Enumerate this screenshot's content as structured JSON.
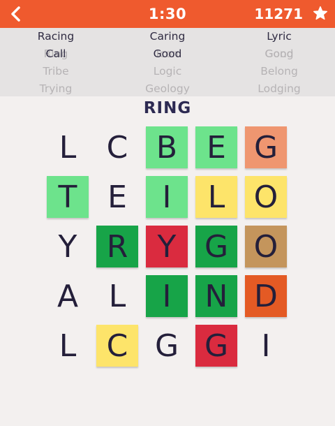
{
  "header": {
    "timer": "1:30",
    "score": "11271",
    "bar_color": "#ef5a2e"
  },
  "word_columns": [
    {
      "active": "Racing",
      "faded": [
        "Ring",
        "Tribe",
        "Trying"
      ],
      "overlap": "Call"
    },
    {
      "active": "Caring",
      "faded": [
        "Icon",
        "Logic",
        "Geology"
      ],
      "overlap": "Good"
    },
    {
      "active": "Lyric",
      "faded": [
        "Gong",
        "Belong",
        "Lodging"
      ],
      "overlap": "Good"
    }
  ],
  "current_word": "RING",
  "colors": {
    "light_green": "#6de38c",
    "dark_green": "#17a448",
    "yellow": "#fde46a",
    "red": "#da2b3f",
    "salmon": "#ef9670",
    "tan": "#c4955c",
    "orange": "#e45a24"
  },
  "grid": [
    [
      {
        "letter": "L",
        "color": null
      },
      {
        "letter": "C",
        "color": null
      },
      {
        "letter": "B",
        "color": "light_green"
      },
      {
        "letter": "E",
        "color": "light_green"
      },
      {
        "letter": "G",
        "color": "salmon"
      }
    ],
    [
      {
        "letter": "T",
        "color": "light_green"
      },
      {
        "letter": "E",
        "color": null
      },
      {
        "letter": "I",
        "color": "light_green"
      },
      {
        "letter": "L",
        "color": "yellow"
      },
      {
        "letter": "O",
        "color": "yellow"
      }
    ],
    [
      {
        "letter": "Y",
        "color": null
      },
      {
        "letter": "R",
        "color": "dark_green"
      },
      {
        "letter": "Y",
        "color": "red"
      },
      {
        "letter": "G",
        "color": "dark_green"
      },
      {
        "letter": "O",
        "color": "tan"
      }
    ],
    [
      {
        "letter": "A",
        "color": null
      },
      {
        "letter": "L",
        "color": null
      },
      {
        "letter": "I",
        "color": "dark_green"
      },
      {
        "letter": "N",
        "color": "dark_green"
      },
      {
        "letter": "D",
        "color": "orange"
      }
    ],
    [
      {
        "letter": "L",
        "color": null
      },
      {
        "letter": "C",
        "color": "yellow"
      },
      {
        "letter": "G",
        "color": null
      },
      {
        "letter": "G",
        "color": "red"
      },
      {
        "letter": "I",
        "color": null
      }
    ]
  ]
}
